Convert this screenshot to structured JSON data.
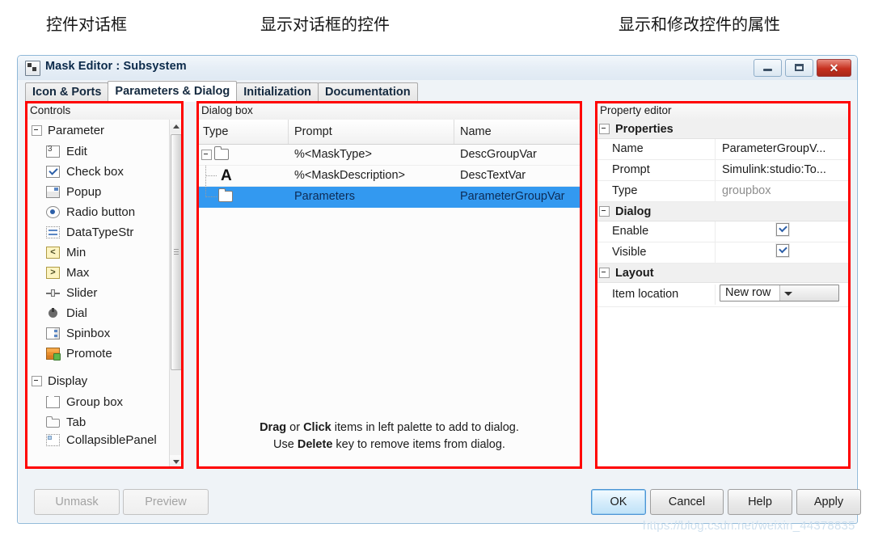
{
  "annotations": [
    {
      "text": "控件对话框"
    },
    {
      "text": "显示对话框的控件"
    },
    {
      "text": "显示和修改控件的属性"
    }
  ],
  "window": {
    "title": "Mask Editor : Subsystem",
    "title_icon": "mask-editor-icon",
    "buttons": {
      "minimize": "minimize-icon",
      "maximize": "maximize-icon",
      "close": "✕"
    }
  },
  "tabs": [
    {
      "label": "Icon & Ports",
      "active": false
    },
    {
      "label": "Parameters & Dialog",
      "active": true
    },
    {
      "label": "Initialization",
      "active": false
    },
    {
      "label": "Documentation",
      "active": false
    }
  ],
  "controls_panel": {
    "header": "Controls",
    "groups": [
      {
        "label": "Parameter",
        "items": [
          {
            "label": "Edit",
            "icon": "edit-icon"
          },
          {
            "label": "Check box",
            "icon": "checkbox-icon"
          },
          {
            "label": "Popup",
            "icon": "popup-icon"
          },
          {
            "label": "Radio button",
            "icon": "radio-button-icon"
          },
          {
            "label": "DataTypeStr",
            "icon": "datatypestr-icon"
          },
          {
            "label": "Min",
            "icon": "min-icon"
          },
          {
            "label": "Max",
            "icon": "max-icon"
          },
          {
            "label": "Slider",
            "icon": "slider-icon"
          },
          {
            "label": "Dial",
            "icon": "dial-icon"
          },
          {
            "label": "Spinbox",
            "icon": "spinbox-icon"
          },
          {
            "label": "Promote",
            "icon": "promote-icon"
          }
        ]
      },
      {
        "label": "Display",
        "items": [
          {
            "label": "Group box",
            "icon": "group-box-icon"
          },
          {
            "label": "Tab",
            "icon": "tab-icon"
          },
          {
            "label": "CollapsiblePanel",
            "icon": "collapsible-panel-icon"
          }
        ]
      }
    ]
  },
  "dialog_panel": {
    "header": "Dialog box",
    "columns": [
      "Type",
      "Prompt",
      "Name"
    ],
    "rows": [
      {
        "type_icon": "folder-icon",
        "prompt": "%<MaskType>",
        "name": "DescGroupVar",
        "selected": false
      },
      {
        "type_icon": "text-icon",
        "prompt": "%<MaskDescription>",
        "name": "DescTextVar",
        "selected": false
      },
      {
        "type_icon": "folder-icon",
        "prompt": "Parameters",
        "name": "ParameterGroupVar",
        "selected": true
      }
    ],
    "hint_line_1": {
      "b1": "Drag",
      "t1": " or ",
      "b2": "Click",
      "t2": " items in left palette to add to dialog."
    },
    "hint_line_2": {
      "t1": "Use ",
      "b1": "Delete",
      "t2": " key to remove items from dialog."
    }
  },
  "property_panel": {
    "header": "Property editor",
    "groups": [
      {
        "label": "Properties",
        "rows": [
          {
            "key": "Name",
            "value": "ParameterGroupV...",
            "kind": "text"
          },
          {
            "key": "Prompt",
            "value": "Simulink:studio:To...",
            "kind": "text"
          },
          {
            "key": "Type",
            "value": "groupbox",
            "kind": "muted"
          }
        ]
      },
      {
        "label": "Dialog",
        "rows": [
          {
            "key": "Enable",
            "value": "checked",
            "kind": "checkbox"
          },
          {
            "key": "Visible",
            "value": "checked",
            "kind": "checkbox"
          }
        ]
      },
      {
        "label": "Layout",
        "rows": [
          {
            "key": "Item location",
            "value": "New row",
            "kind": "combo"
          }
        ]
      }
    ]
  },
  "footer_buttons": {
    "unmask": "Unmask",
    "preview": "Preview",
    "ok": "OK",
    "cancel": "Cancel",
    "help": "Help",
    "apply": "Apply"
  },
  "watermark": "https://blog.csdn.net/weixin_44378835",
  "colors": {
    "selection_blue": "#3399f0",
    "highlight_red": "#ff0000",
    "window_border": "#8fb8d8"
  }
}
